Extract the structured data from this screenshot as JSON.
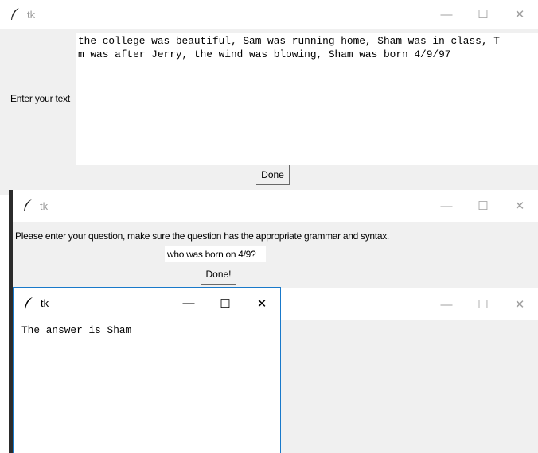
{
  "window_main": {
    "title": "tk",
    "label": "Enter your text",
    "text": "the college was beautiful, Sam was running home, Sham was in class, T\nm was after Jerry, the wind was blowing, Sham was born 4/9/97",
    "done_label": "Done"
  },
  "window_question": {
    "title": "tk",
    "prompt": "Please enter your question, make sure the question has the appropriate grammar and syntax.",
    "question_value": "who was born on 4/9?",
    "done_label": "Done!"
  },
  "window_empty": {
    "title": "tk"
  },
  "window_answer": {
    "title": "tk",
    "answer": "The answer is Sham"
  },
  "window_controls": {
    "minimize": "—",
    "maximize": "☐",
    "close": "✕"
  },
  "icons": {
    "app": "feather-icon"
  }
}
